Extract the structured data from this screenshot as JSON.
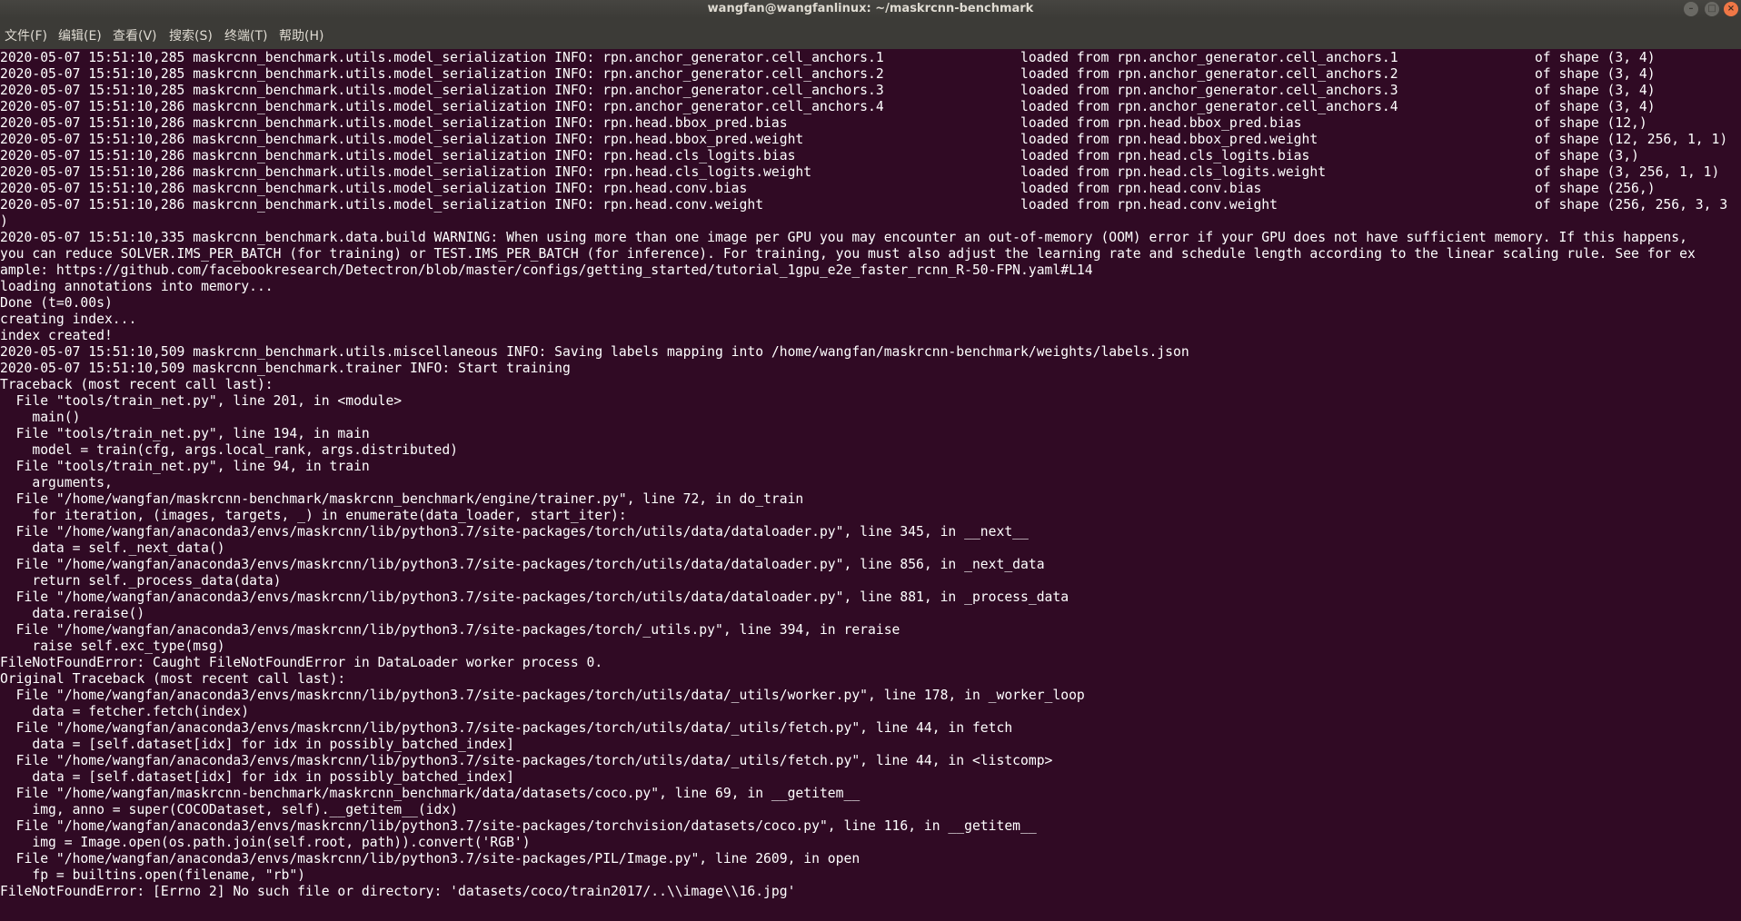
{
  "window": {
    "title": "wangfan@wangfanlinux: ~/maskrcnn-benchmark",
    "controls": [
      "minimize-icon",
      "maximize-icon",
      "close-icon"
    ]
  },
  "menubar": {
    "items": [
      {
        "label": "文件(F)"
      },
      {
        "label": "编辑(E)"
      },
      {
        "label": "查看(V)"
      },
      {
        "label": "搜索(S)"
      },
      {
        "label": "终端(T)"
      },
      {
        "label": "帮助(H)"
      }
    ]
  },
  "terminal": {
    "colors": {
      "background": "#300a24",
      "foreground": "#ffffff"
    },
    "lines": [
      "2020-05-07 15:51:10,285 maskrcnn_benchmark.utils.model_serialization INFO: rpn.anchor_generator.cell_anchors.1                 loaded from rpn.anchor_generator.cell_anchors.1                 of shape (3, 4)",
      "2020-05-07 15:51:10,285 maskrcnn_benchmark.utils.model_serialization INFO: rpn.anchor_generator.cell_anchors.2                 loaded from rpn.anchor_generator.cell_anchors.2                 of shape (3, 4)",
      "2020-05-07 15:51:10,285 maskrcnn_benchmark.utils.model_serialization INFO: rpn.anchor_generator.cell_anchors.3                 loaded from rpn.anchor_generator.cell_anchors.3                 of shape (3, 4)",
      "2020-05-07 15:51:10,286 maskrcnn_benchmark.utils.model_serialization INFO: rpn.anchor_generator.cell_anchors.4                 loaded from rpn.anchor_generator.cell_anchors.4                 of shape (3, 4)",
      "2020-05-07 15:51:10,286 maskrcnn_benchmark.utils.model_serialization INFO: rpn.head.bbox_pred.bias                             loaded from rpn.head.bbox_pred.bias                             of shape (12,)",
      "2020-05-07 15:51:10,286 maskrcnn_benchmark.utils.model_serialization INFO: rpn.head.bbox_pred.weight                           loaded from rpn.head.bbox_pred.weight                           of shape (12, 256, 1, 1)",
      "2020-05-07 15:51:10,286 maskrcnn_benchmark.utils.model_serialization INFO: rpn.head.cls_logits.bias                            loaded from rpn.head.cls_logits.bias                            of shape (3,)",
      "2020-05-07 15:51:10,286 maskrcnn_benchmark.utils.model_serialization INFO: rpn.head.cls_logits.weight                          loaded from rpn.head.cls_logits.weight                          of shape (3, 256, 1, 1)",
      "2020-05-07 15:51:10,286 maskrcnn_benchmark.utils.model_serialization INFO: rpn.head.conv.bias                                  loaded from rpn.head.conv.bias                                  of shape (256,)",
      "2020-05-07 15:51:10,286 maskrcnn_benchmark.utils.model_serialization INFO: rpn.head.conv.weight                                loaded from rpn.head.conv.weight                                of shape (256, 256, 3, 3",
      ")",
      "2020-05-07 15:51:10,335 maskrcnn_benchmark.data.build WARNING: When using more than one image per GPU you may encounter an out-of-memory (OOM) error if your GPU does not have sufficient memory. If this happens,",
      "you can reduce SOLVER.IMS_PER_BATCH (for training) or TEST.IMS_PER_BATCH (for inference). For training, you must also adjust the learning rate and schedule length according to the linear scaling rule. See for ex",
      "ample: https://github.com/facebookresearch/Detectron/blob/master/configs/getting_started/tutorial_1gpu_e2e_faster_rcnn_R-50-FPN.yaml#L14",
      "loading annotations into memory...",
      "Done (t=0.00s)",
      "creating index...",
      "index created!",
      "2020-05-07 15:51:10,509 maskrcnn_benchmark.utils.miscellaneous INFO: Saving labels mapping into /home/wangfan/maskrcnn-benchmark/weights/labels.json",
      "2020-05-07 15:51:10,509 maskrcnn_benchmark.trainer INFO: Start training",
      "Traceback (most recent call last):",
      "  File \"tools/train_net.py\", line 201, in <module>",
      "    main()",
      "  File \"tools/train_net.py\", line 194, in main",
      "    model = train(cfg, args.local_rank, args.distributed)",
      "  File \"tools/train_net.py\", line 94, in train",
      "    arguments,",
      "  File \"/home/wangfan/maskrcnn-benchmark/maskrcnn_benchmark/engine/trainer.py\", line 72, in do_train",
      "    for iteration, (images, targets, _) in enumerate(data_loader, start_iter):",
      "  File \"/home/wangfan/anaconda3/envs/maskrcnn/lib/python3.7/site-packages/torch/utils/data/dataloader.py\", line 345, in __next__",
      "    data = self._next_data()",
      "  File \"/home/wangfan/anaconda3/envs/maskrcnn/lib/python3.7/site-packages/torch/utils/data/dataloader.py\", line 856, in _next_data",
      "    return self._process_data(data)",
      "  File \"/home/wangfan/anaconda3/envs/maskrcnn/lib/python3.7/site-packages/torch/utils/data/dataloader.py\", line 881, in _process_data",
      "    data.reraise()",
      "  File \"/home/wangfan/anaconda3/envs/maskrcnn/lib/python3.7/site-packages/torch/_utils.py\", line 394, in reraise",
      "    raise self.exc_type(msg)",
      "FileNotFoundError: Caught FileNotFoundError in DataLoader worker process 0.",
      "Original Traceback (most recent call last):",
      "  File \"/home/wangfan/anaconda3/envs/maskrcnn/lib/python3.7/site-packages/torch/utils/data/_utils/worker.py\", line 178, in _worker_loop",
      "    data = fetcher.fetch(index)",
      "  File \"/home/wangfan/anaconda3/envs/maskrcnn/lib/python3.7/site-packages/torch/utils/data/_utils/fetch.py\", line 44, in fetch",
      "    data = [self.dataset[idx] for idx in possibly_batched_index]",
      "  File \"/home/wangfan/anaconda3/envs/maskrcnn/lib/python3.7/site-packages/torch/utils/data/_utils/fetch.py\", line 44, in <listcomp>",
      "    data = [self.dataset[idx] for idx in possibly_batched_index]",
      "  File \"/home/wangfan/maskrcnn-benchmark/maskrcnn_benchmark/data/datasets/coco.py\", line 69, in __getitem__",
      "    img, anno = super(COCODataset, self).__getitem__(idx)",
      "  File \"/home/wangfan/anaconda3/envs/maskrcnn/lib/python3.7/site-packages/torchvision/datasets/coco.py\", line 116, in __getitem__",
      "    img = Image.open(os.path.join(self.root, path)).convert('RGB')",
      "  File \"/home/wangfan/anaconda3/envs/maskrcnn/lib/python3.7/site-packages/PIL/Image.py\", line 2609, in open",
      "    fp = builtins.open(filename, \"rb\")",
      "FileNotFoundError: [Errno 2] No such file or directory: 'datasets/coco/train2017/..\\\\image\\\\16.jpg'"
    ]
  }
}
